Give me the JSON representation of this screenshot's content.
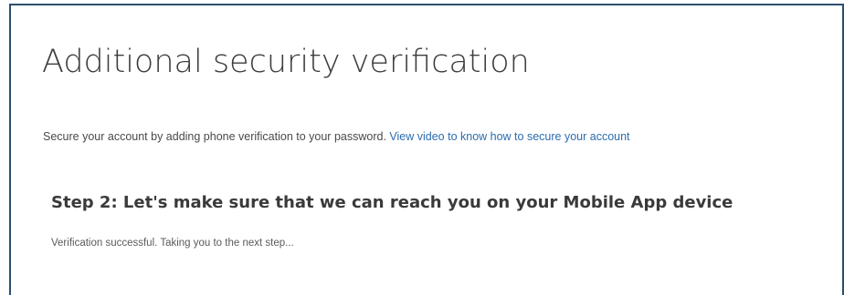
{
  "page": {
    "title": "Additional security verification",
    "intro_text": "Secure your account by adding phone verification to your password.",
    "intro_link": "View video to know how to secure your account"
  },
  "step": {
    "heading": "Step 2: Let's make sure that we can reach you on your Mobile App device",
    "status": "Verification successful. Taking you to the next step..."
  },
  "colors": {
    "frame_border": "#2b4f6e",
    "link": "#2b6cb0",
    "title_text": "#3d3d3d"
  }
}
